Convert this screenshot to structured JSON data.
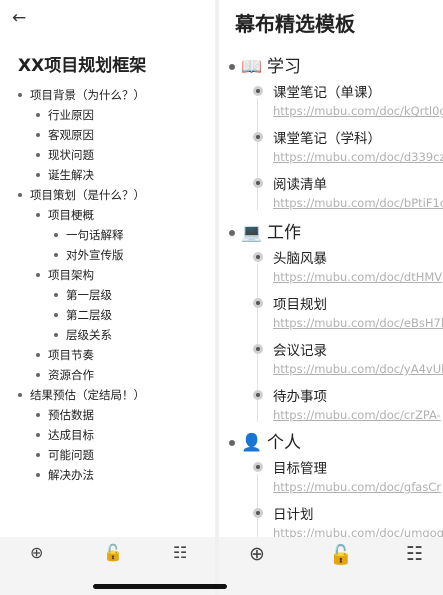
{
  "left": {
    "back_icon": "arrow-left-icon",
    "title": "XX项目规划框架",
    "outline": [
      {
        "level": 0,
        "text": "项目背景（为什么？）"
      },
      {
        "level": 1,
        "text": "行业原因"
      },
      {
        "level": 1,
        "text": "客观原因"
      },
      {
        "level": 1,
        "text": "现状问题"
      },
      {
        "level": 1,
        "text": "诞生解决"
      },
      {
        "level": 0,
        "text": "项目策划（是什么？）"
      },
      {
        "level": 1,
        "text": "项目梗概"
      },
      {
        "level": 2,
        "text": "一句话解释"
      },
      {
        "level": 2,
        "text": "对外宣传版"
      },
      {
        "level": 1,
        "text": "项目架构"
      },
      {
        "level": 2,
        "text": "第一层级"
      },
      {
        "level": 2,
        "text": "第二层级"
      },
      {
        "level": 2,
        "text": "层级关系"
      },
      {
        "level": 1,
        "text": "项目节奏"
      },
      {
        "level": 1,
        "text": "资源合作"
      },
      {
        "level": 0,
        "text": "结果预估（定结局！）"
      },
      {
        "level": 1,
        "text": "预估数据"
      },
      {
        "level": 1,
        "text": "达成目标"
      },
      {
        "level": 1,
        "text": "可能问题"
      },
      {
        "level": 1,
        "text": "解决办法"
      }
    ]
  },
  "right": {
    "title": "幕布精选模板",
    "sections": [
      {
        "icon": "📖",
        "label": "学习",
        "items": [
          {
            "text": "课堂笔记（单课）",
            "url": "https://mubu.com/doc/kQrtl0g"
          },
          {
            "text": "课堂笔记（学科）",
            "url": "https://mubu.com/doc/d339cz"
          },
          {
            "text": "阅读清单",
            "url": "https://mubu.com/doc/bPtiF1o"
          }
        ]
      },
      {
        "icon": "💻",
        "label": "工作",
        "items": [
          {
            "text": "头脑风暴",
            "url": "https://mubu.com/doc/dtHMV"
          },
          {
            "text": "项目规划",
            "url": "https://mubu.com/doc/eBsH7l"
          },
          {
            "text": "会议记录",
            "url": "https://mubu.com/doc/yA4vUl"
          },
          {
            "text": "待办事项",
            "url": "https://mubu.com/doc/crZPA-"
          }
        ]
      },
      {
        "icon": "👤",
        "label": "个人",
        "items": [
          {
            "text": "目标管理",
            "url": "https://mubu.com/doc/gfasCr"
          },
          {
            "text": "日计划",
            "url": "https://mubu.com/doc/umgog"
          }
        ]
      }
    ]
  },
  "toolbar_icons": [
    "add-circle-icon",
    "lock-open-icon",
    "list-icon"
  ]
}
